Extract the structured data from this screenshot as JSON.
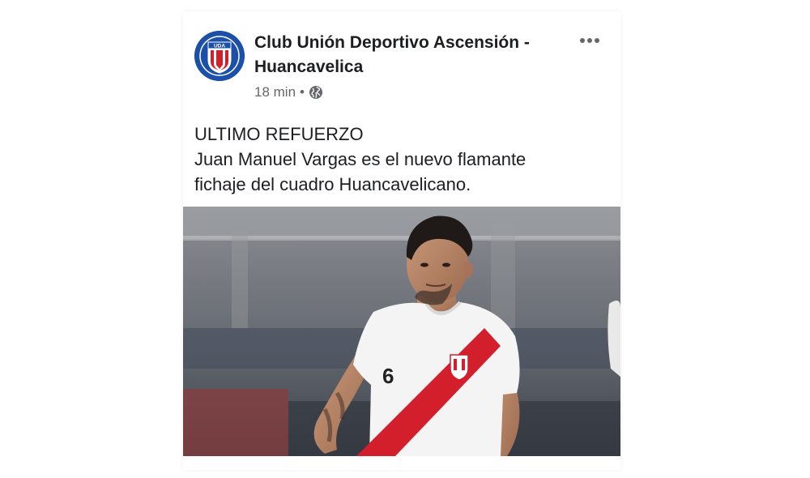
{
  "post": {
    "page_name": "Club Unión Deportivo Ascensión - Huancavelica",
    "avatar_initials": "UDA",
    "time": "18 min",
    "separator": "•",
    "audience_icon": "globe-icon",
    "menu_icon": "more-options-icon",
    "text_lines": [
      "ULTIMO REFUERZO",
      "Juan Manuel Vargas es el nuevo flamante",
      "fichaje del cuadro Huancavelicano."
    ],
    "photo": {
      "jersey_number": "6"
    }
  },
  "colors": {
    "brand_blue": "#1c4fa8",
    "peru_red": "#d21f2b",
    "text_primary": "#1c1e21",
    "text_secondary": "#65676b"
  }
}
